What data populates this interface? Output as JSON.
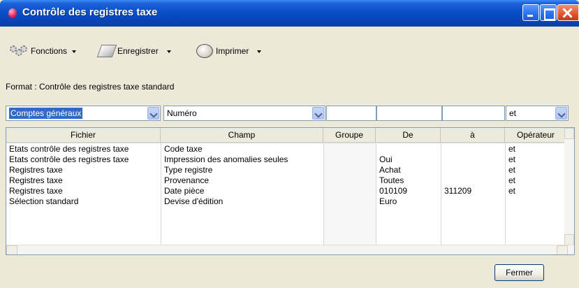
{
  "window": {
    "title": "Contrôle des registres taxe"
  },
  "toolbar": {
    "fonctions": "Fonctions",
    "enregistrer": "Enregistrer",
    "imprimer": "Imprimer"
  },
  "format_label": "Format : Contrôle des registres taxe standard",
  "filters": {
    "account_type": "Comptes généraux",
    "sort_field": "Numéro",
    "value_1": "",
    "value_2": "",
    "value_3": "",
    "operator": "et"
  },
  "grid": {
    "columns": [
      "Fichier",
      "Champ",
      "Groupe",
      "De",
      "à",
      "Opérateur"
    ],
    "rows": [
      [
        "Etats contrôle des registres taxe",
        "Code taxe",
        "",
        "",
        "",
        "et"
      ],
      [
        "Etats contrôle des registres taxe",
        "Impression des anomalies seules",
        "",
        "Oui",
        "",
        "et"
      ],
      [
        "Registres taxe",
        "Type registre",
        "",
        "Achat",
        "",
        "et"
      ],
      [
        "Registres taxe",
        "Provenance",
        "",
        "Toutes",
        "",
        "et"
      ],
      [
        "Registres taxe",
        "Date pièce",
        "",
        "010109",
        "311209",
        "et"
      ],
      [
        "Sélection standard",
        "Devise d'édition",
        "",
        "Euro",
        "",
        ""
      ]
    ]
  },
  "buttons": {
    "fermer": "Fermer"
  }
}
